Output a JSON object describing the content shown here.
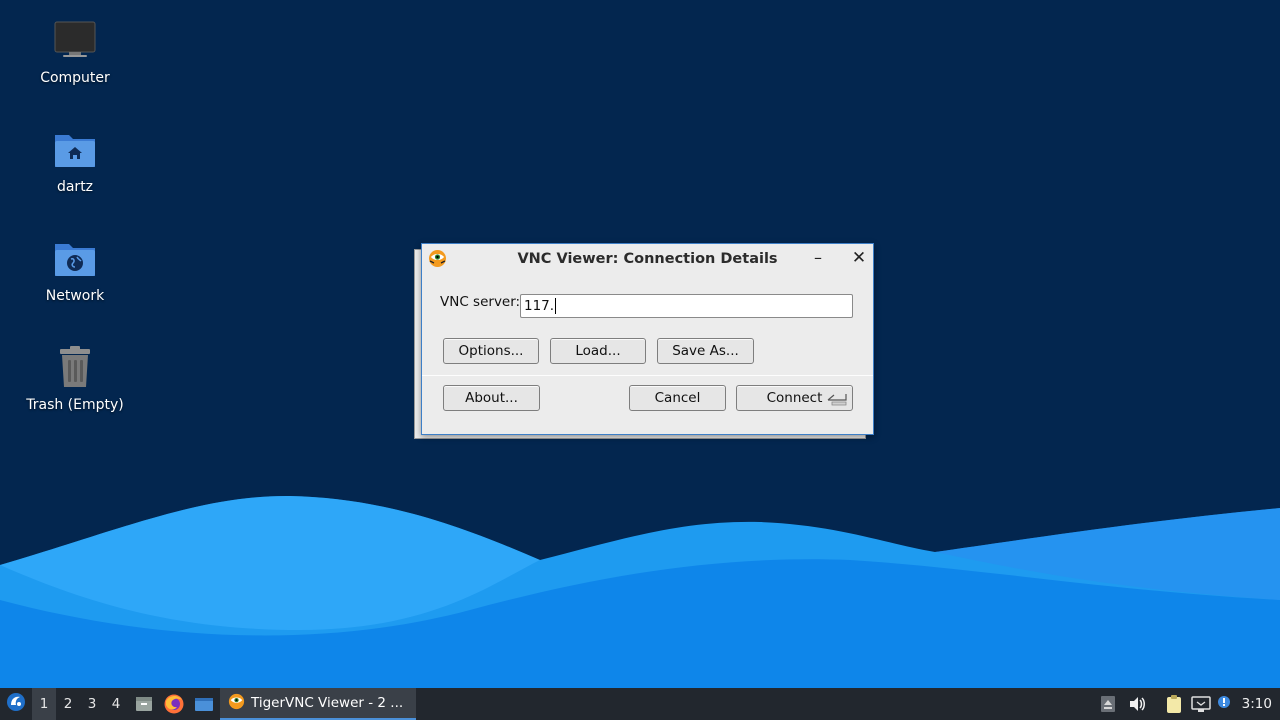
{
  "desktop": {
    "icons": [
      {
        "label": "Computer",
        "icon": "monitor-icon"
      },
      {
        "label": "dartz",
        "icon": "home-folder-icon"
      },
      {
        "label": "Network",
        "icon": "network-folder-icon"
      },
      {
        "label": "Trash (Empty)",
        "icon": "trash-icon"
      }
    ]
  },
  "window": {
    "title": "VNC Viewer: Connection Details",
    "minimize_symbol": "–",
    "close_symbol": "✕",
    "server_label": "VNC server:",
    "server_value": "117.",
    "buttons": {
      "options": "Options...",
      "load": "Load...",
      "save_as": "Save As...",
      "about": "About...",
      "cancel": "Cancel",
      "connect": "Connect"
    }
  },
  "taskbar": {
    "workspaces": [
      "1",
      "2",
      "3",
      "4"
    ],
    "active_workspace": "1",
    "task_label": "TigerVNC Viewer - 2 ...",
    "clock": "3:10",
    "launchers": [
      "file-manager-icon",
      "firefox-icon",
      "show-desktop-icon"
    ],
    "tray": [
      "eject-icon",
      "volume-icon",
      "clipboard-icon",
      "network-icon",
      "notification-icon"
    ]
  },
  "colors": {
    "desktop_bg": "#03264f",
    "wave_light": "#1e9bf0",
    "wave_dark": "#0a6fd6",
    "window_border": "#3d7fc7",
    "taskbar_bg": "#22272e"
  }
}
